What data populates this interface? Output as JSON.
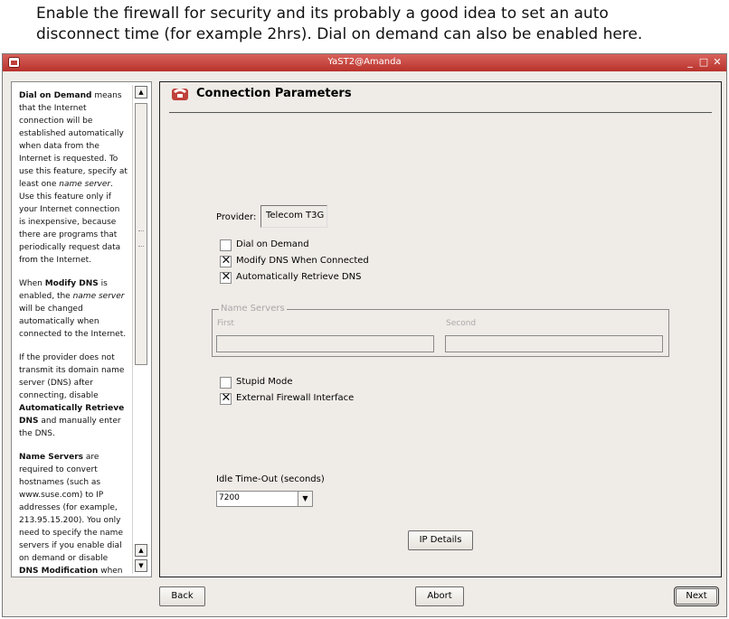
{
  "caption": {
    "line1": "Enable the firewall for security and its probably a good idea to set an auto",
    "line2": "disconnect time (for example 2hrs).  Dial on demand can also be enabled here."
  },
  "window": {
    "title": "YaST2@Amanda",
    "controls": {
      "minimize": "_",
      "maximize": "□",
      "close": "✕"
    }
  },
  "help": {
    "p1_bold": "Dial on Demand",
    "p1_a": " means that the Internet connection will be established automatically when data from the Internet is requested. To use this feature, specify at least one ",
    "p1_italic": "name server",
    "p1_b": ". Use this feature only if your Internet connection is inexpensive, because there are programs that periodically request data from the Internet.",
    "p2_a": "When ",
    "p2_bold": "Modify DNS",
    "p2_b": " is enabled, the ",
    "p2_italic": "name server",
    "p2_c": " will be changed automatically when connected to the Internet.",
    "p3_a": "If the provider does not transmit its domain name server (DNS) after connecting, disable ",
    "p3_bold": "Automatically Retrieve DNS",
    "p3_b": " and manually enter the DNS.",
    "p4_bold": "Name Servers",
    "p4_a": " are required to convert hostnames (such as www.suse.com) to IP addresses (for example, 213.95.15.200). You only need to specify the name servers if you enable dial on demand or disable ",
    "p4_bold2": "DNS Modification",
    "p4_b": " when"
  },
  "main": {
    "title": "Connection Parameters",
    "provider_label": "Provider:",
    "provider_value": "Telecom T3G",
    "dial_on_demand": {
      "label": "Dial on Demand",
      "checked": false
    },
    "modify_dns": {
      "label": "Modify DNS When Connected",
      "checked": true
    },
    "auto_dns": {
      "label": "Automatically Retrieve DNS",
      "checked": true
    },
    "name_servers": {
      "legend": "Name Servers",
      "first_label": "First",
      "second_label": "Second",
      "first_value": "",
      "second_value": ""
    },
    "stupid_mode": {
      "label": "Stupid Mode",
      "checked": false
    },
    "external_firewall": {
      "label": "External Firewall Interface",
      "checked": true
    },
    "idle_timeout_label": "Idle Time-Out (seconds)",
    "idle_timeout_value": "7200",
    "ip_details_label": "IP Details"
  },
  "footer": {
    "back": "Back",
    "abort": "Abort",
    "next": "Next"
  },
  "colors": {
    "titlebar": "#c0403a",
    "window_bg": "#efebe7"
  }
}
